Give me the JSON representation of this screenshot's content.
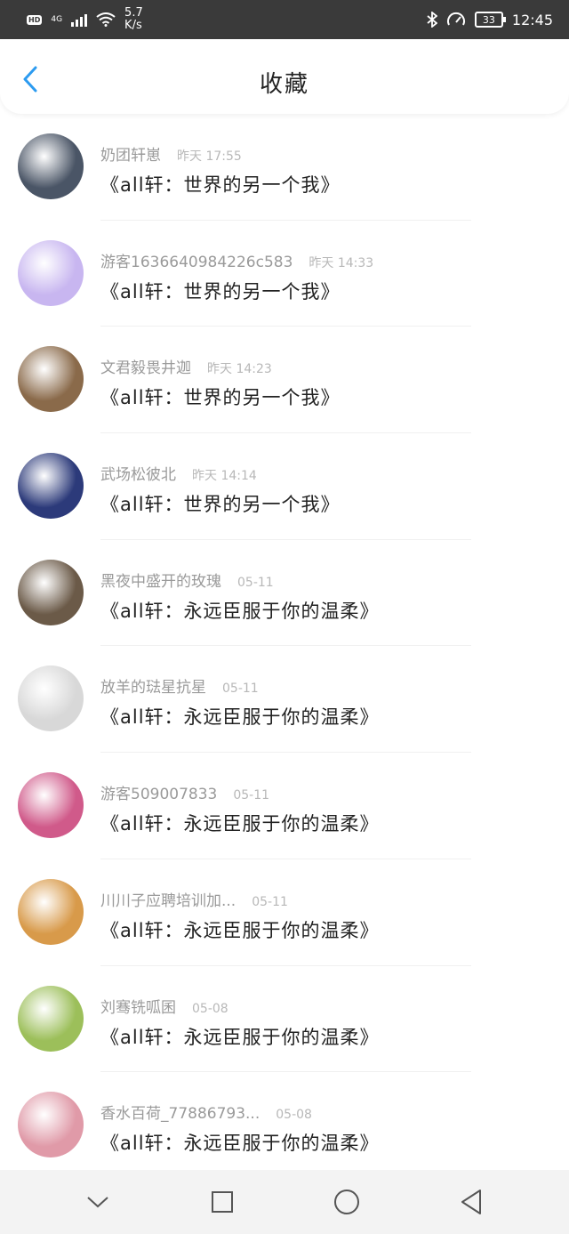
{
  "statusbar": {
    "hd": "HD",
    "network": "4G",
    "speed_value": "5.7",
    "speed_unit": "K/s",
    "battery": "33",
    "time": "12:45"
  },
  "header": {
    "title": "收藏"
  },
  "items": [
    {
      "name": "奶团轩崽",
      "time": "昨天 17:55",
      "book": "《all轩：世界的另一个我》",
      "avatar_color": "#4a5566"
    },
    {
      "name": "游客1636640984226c583",
      "time": "昨天 14:33",
      "book": "《all轩：世界的另一个我》",
      "avatar_color": "#c8b6f0"
    },
    {
      "name": "文君毅畏井迦",
      "time": "昨天 14:23",
      "book": "《all轩：世界的另一个我》",
      "avatar_color": "#8a6a4a"
    },
    {
      "name": "武场松彼北",
      "time": "昨天 14:14",
      "book": "《all轩：世界的另一个我》",
      "avatar_color": "#2c3a7a"
    },
    {
      "name": "黑夜中盛开的玫瑰",
      "time": "05-11",
      "book": "《all轩：永远臣服于你的温柔》",
      "avatar_color": "#6b5a48"
    },
    {
      "name": "放羊的琺星抗星",
      "time": "05-11",
      "book": "《all轩：永远臣服于你的温柔》",
      "avatar_color": "#d8d8d8"
    },
    {
      "name": "游客509007833",
      "time": "05-11",
      "book": "《all轩：永远臣服于你的温柔》",
      "avatar_color": "#d05a8a"
    },
    {
      "name": "川川子应聘培训加...",
      "time": "05-11",
      "book": "《all轩：永远臣服于你的温柔》",
      "avatar_color": "#d89a4a"
    },
    {
      "name": "刘骞铣呱囷",
      "time": "05-08",
      "book": "《all轩：永远臣服于你的温柔》",
      "avatar_color": "#9cbf5a"
    },
    {
      "name": "香水百荷_77886793...",
      "time": "05-08",
      "book": "《all轩：永远臣服于你的温柔》",
      "avatar_color": "#e09aa8"
    }
  ],
  "colors": {
    "accent": "#2c9bf0",
    "status_bar": "#3a3a3a",
    "name_text": "#9a9a9a",
    "time_text": "#b8b8b8"
  },
  "icons": {
    "back": "chevron-left-icon",
    "nav_down": "chevron-down-icon",
    "nav_recent": "square-icon",
    "nav_home": "circle-icon",
    "nav_back": "triangle-back-icon"
  }
}
